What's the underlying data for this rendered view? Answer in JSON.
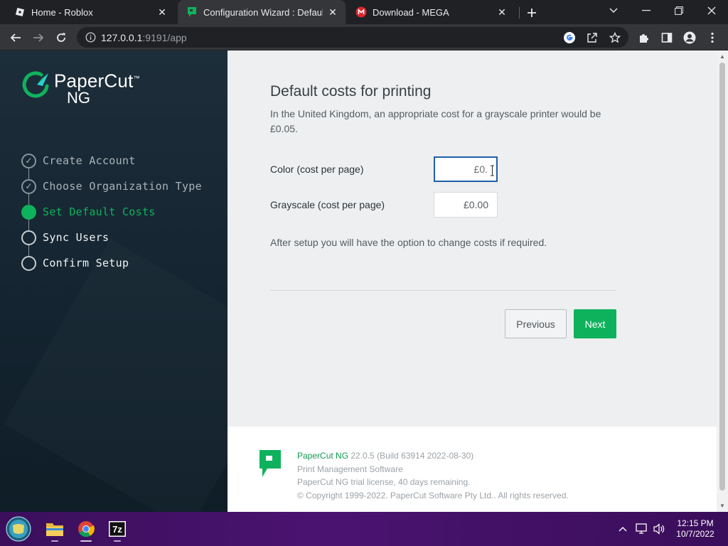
{
  "browser": {
    "tabs": [
      {
        "title": "Home - Roblox",
        "icon": "roblox-icon"
      },
      {
        "title": "Configuration Wizard : Default co",
        "icon": "papercut-icon"
      },
      {
        "title": "Download - MEGA",
        "icon": "mega-icon"
      }
    ],
    "url_host": "127.0.0.1",
    "url_rest": ":9191/app"
  },
  "sidebar": {
    "logo_line1": "PaperCut",
    "logo_tm": "™",
    "logo_line2": "NG",
    "steps": [
      {
        "label": "Create Account",
        "state": "done"
      },
      {
        "label": "Choose Organization Type",
        "state": "done"
      },
      {
        "label": "Set Default Costs",
        "state": "current"
      },
      {
        "label": "Sync Users",
        "state": "todo"
      },
      {
        "label": "Confirm Setup",
        "state": "todo"
      }
    ]
  },
  "main": {
    "heading": "Default costs for printing",
    "lead": "In the United Kingdom, an appropriate cost for a grayscale printer would be £0.05.",
    "color_label": "Color (cost per page)",
    "color_value": "£0.",
    "grayscale_label": "Grayscale (cost per page)",
    "grayscale_value": "£0.00",
    "note": "After setup you will have the option to change costs if required.",
    "previous_label": "Previous",
    "next_label": "Next",
    "accent": "#0fb25c"
  },
  "footer": {
    "product": "PaperCut NG",
    "version": " 22.0.5 (Build 63914 2022-08-30)",
    "line2": "Print Management Software",
    "line3": "PaperCut NG trial license, 40 days remaining.",
    "line4": "© Copyright 1999-2022. PaperCut Software Pty Ltd.. All rights reserved."
  },
  "taskbar": {
    "time": "12:15 PM",
    "date": "10/7/2022",
    "apps": [
      "start-orb-icon",
      "file-explorer-icon",
      "chrome-icon",
      "7zip-icon"
    ]
  }
}
